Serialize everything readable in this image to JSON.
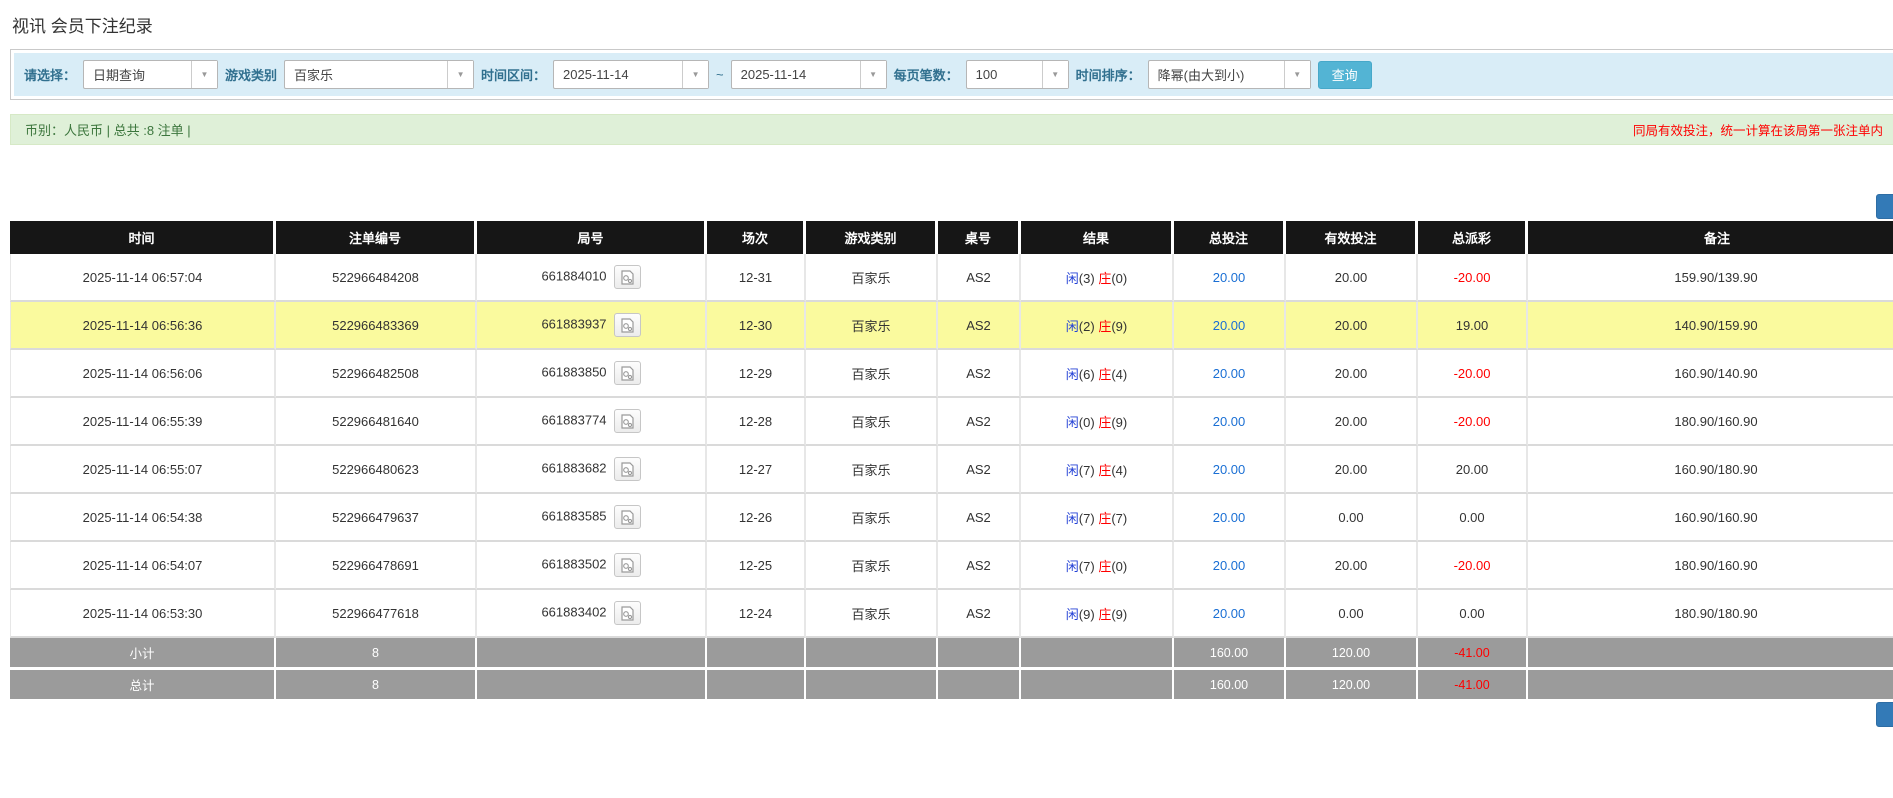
{
  "page": {
    "title": "视讯 会员下注纪录"
  },
  "filters": {
    "select_label": "请选择：",
    "select_value": "日期查询",
    "game_type_label": "游戏类别",
    "game_type_value": "百家乐",
    "time_range_label": "时间区间：",
    "date_from": "2025-11-14",
    "range_separator": "~",
    "date_to": "2025-11-14",
    "page_size_label": "每页笔数：",
    "page_size_value": "100",
    "sort_label": "时间排序：",
    "sort_value": "降幂(由大到小)",
    "query_button": "查询"
  },
  "summary": {
    "left": "币别：人民币 | 总共 :8 注单 |",
    "right_notice": "同局有效投注，统一计算在该局第一张注单内"
  },
  "table": {
    "headers": [
      "时间",
      "注单编号",
      "局号",
      "场次",
      "游戏类别",
      "桌号",
      "结果",
      "总投注",
      "有效投注",
      "总派彩",
      "备注"
    ],
    "rows": [
      {
        "time": "2025-11-14 06:57:04",
        "bet_id": "522966484208",
        "round_id": "661884010",
        "session": "12-31",
        "game": "百家乐",
        "table_no": "AS2",
        "result": {
          "player_label": "闲",
          "player_value": "(3)",
          "banker_label": "庄",
          "banker_value": "(0)"
        },
        "total_bet": "20.00",
        "valid_bet": "20.00",
        "payout": "-20.00",
        "remark": "159.90/139.90",
        "highlight": false
      },
      {
        "time": "2025-11-14 06:56:36",
        "bet_id": "522966483369",
        "round_id": "661883937",
        "session": "12-30",
        "game": "百家乐",
        "table_no": "AS2",
        "result": {
          "player_label": "闲",
          "player_value": "(2)",
          "banker_label": "庄",
          "banker_value": "(9)"
        },
        "total_bet": "20.00",
        "valid_bet": "20.00",
        "payout": "19.00",
        "remark": "140.90/159.90",
        "highlight": true
      },
      {
        "time": "2025-11-14 06:56:06",
        "bet_id": "522966482508",
        "round_id": "661883850",
        "session": "12-29",
        "game": "百家乐",
        "table_no": "AS2",
        "result": {
          "player_label": "闲",
          "player_value": "(6)",
          "banker_label": "庄",
          "banker_value": "(4)"
        },
        "total_bet": "20.00",
        "valid_bet": "20.00",
        "payout": "-20.00",
        "remark": "160.90/140.90",
        "highlight": false
      },
      {
        "time": "2025-11-14 06:55:39",
        "bet_id": "522966481640",
        "round_id": "661883774",
        "session": "12-28",
        "game": "百家乐",
        "table_no": "AS2",
        "result": {
          "player_label": "闲",
          "player_value": "(0)",
          "banker_label": "庄",
          "banker_value": "(9)"
        },
        "total_bet": "20.00",
        "valid_bet": "20.00",
        "payout": "-20.00",
        "remark": "180.90/160.90",
        "highlight": false
      },
      {
        "time": "2025-11-14 06:55:07",
        "bet_id": "522966480623",
        "round_id": "661883682",
        "session": "12-27",
        "game": "百家乐",
        "table_no": "AS2",
        "result": {
          "player_label": "闲",
          "player_value": "(7)",
          "banker_label": "庄",
          "banker_value": "(4)"
        },
        "total_bet": "20.00",
        "valid_bet": "20.00",
        "payout": "20.00",
        "remark": "160.90/180.90",
        "highlight": false
      },
      {
        "time": "2025-11-14 06:54:38",
        "bet_id": "522966479637",
        "round_id": "661883585",
        "session": "12-26",
        "game": "百家乐",
        "table_no": "AS2",
        "result": {
          "player_label": "闲",
          "player_value": "(7)",
          "banker_label": "庄",
          "banker_value": "(7)"
        },
        "total_bet": "20.00",
        "valid_bet": "0.00",
        "payout": "0.00",
        "remark": "160.90/160.90",
        "highlight": false
      },
      {
        "time": "2025-11-14 06:54:07",
        "bet_id": "522966478691",
        "round_id": "661883502",
        "session": "12-25",
        "game": "百家乐",
        "table_no": "AS2",
        "result": {
          "player_label": "闲",
          "player_value": "(7)",
          "banker_label": "庄",
          "banker_value": "(0)"
        },
        "total_bet": "20.00",
        "valid_bet": "20.00",
        "payout": "-20.00",
        "remark": "180.90/160.90",
        "highlight": false
      },
      {
        "time": "2025-11-14 06:53:30",
        "bet_id": "522966477618",
        "round_id": "661883402",
        "session": "12-24",
        "game": "百家乐",
        "table_no": "AS2",
        "result": {
          "player_label": "闲",
          "player_value": "(9)",
          "banker_label": "庄",
          "banker_value": "(9)"
        },
        "total_bet": "20.00",
        "valid_bet": "0.00",
        "payout": "0.00",
        "remark": "180.90/180.90",
        "highlight": false
      }
    ],
    "subtotal": {
      "label": "小计",
      "count": "8",
      "total_bet": "160.00",
      "valid_bet": "120.00",
      "payout": "-41.00"
    },
    "total": {
      "label": "总计",
      "count": "8",
      "total_bet": "160.00",
      "valid_bet": "120.00",
      "payout": "-41.00"
    }
  },
  "colors": {
    "filter_bg": "#d9edf7",
    "query_button_bg": "#53b4d4",
    "summary_bg": "#dff0d8",
    "summary_text": "#3c763d",
    "notice_red": "#ff0000",
    "header_black": "#161616",
    "footer_gray": "#9b9b9b",
    "highlight_yellow": "#fafa9e",
    "link_blue": "#1a6fd4",
    "player_blue": "#2442d6",
    "banker_red": "#ff0000",
    "accent_blue": "#337ab7"
  }
}
